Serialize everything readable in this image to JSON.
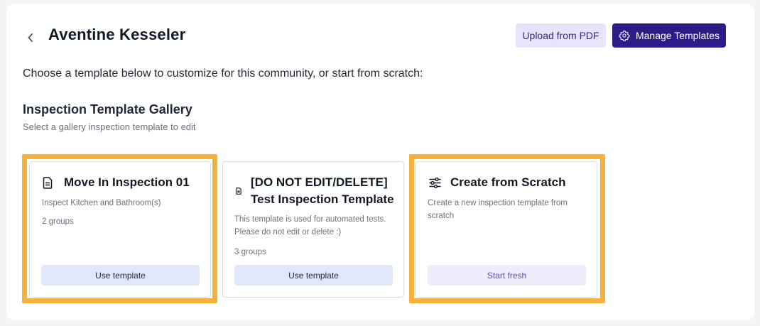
{
  "header": {
    "title": "Aventine Kesseler",
    "upload_label": "Upload from PDF",
    "manage_label": "Manage Templates"
  },
  "intro": "Choose a template below to customize for this community, or start from scratch:",
  "gallery": {
    "title": "Inspection Template Gallery",
    "subtitle": "Select a gallery inspection template to edit"
  },
  "cards": [
    {
      "icon": "document-icon",
      "title": "Move In Inspection 01",
      "description": "Inspect Kitchen and Bathroom(s)",
      "groups": "2 groups",
      "button": "Use template"
    },
    {
      "icon": "document-icon",
      "title_line1": "[DO NOT EDIT/DELETE]",
      "title_line2": "Test Inspection Template",
      "description_line1": "This template is used for automated tests.",
      "description_line2": "Please do not edit or delete :)",
      "groups": "3 groups",
      "button": "Use template"
    },
    {
      "icon": "sliders-icon",
      "title": "Create from Scratch",
      "description_line1": "Create a new inspection template from",
      "description_line2": "scratch",
      "button": "Start fresh"
    }
  ],
  "colors": {
    "primary": "#2e1b87",
    "highlight": "#f5b13d",
    "use_button": "#dfe8fb",
    "fresh_button": "#efecfb"
  }
}
